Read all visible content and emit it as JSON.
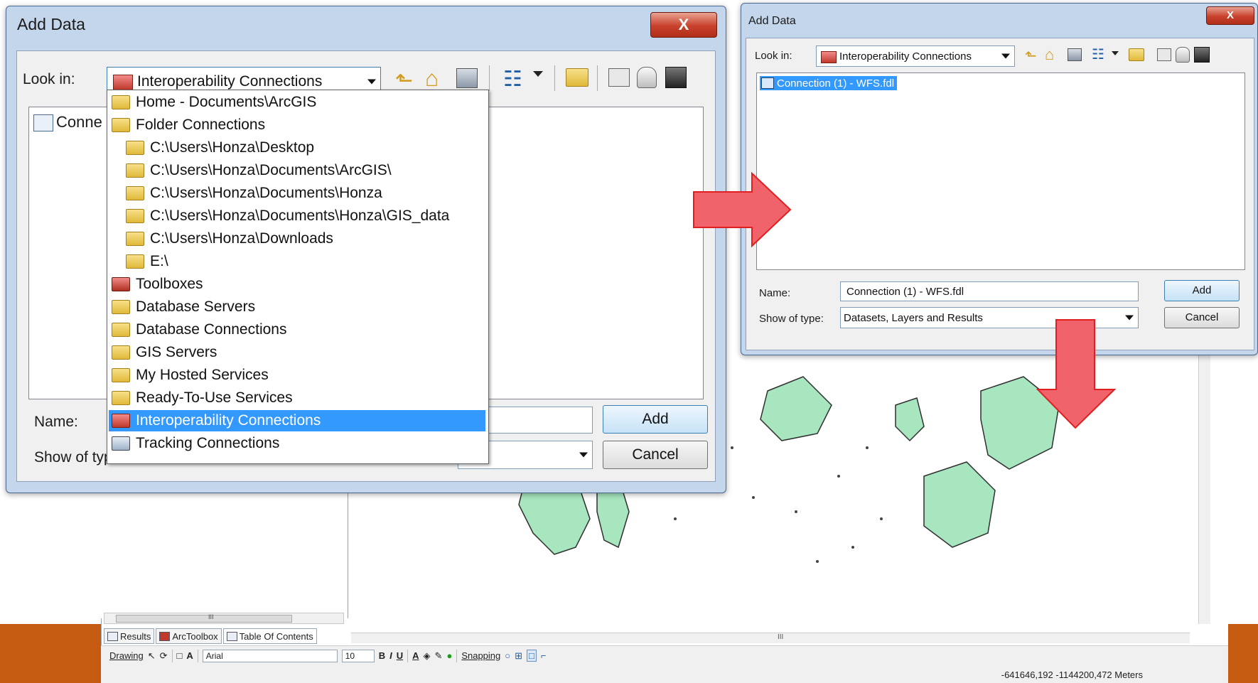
{
  "left_dialog": {
    "title": "Add Data",
    "look_in_label": "Look in:",
    "look_in_value": "Interoperability Connections",
    "list_item_partial": "Conne",
    "name_label": "Name:",
    "show_type_label": "Show of typ",
    "add_button": "Add",
    "cancel_button": "Cancel",
    "close_button": "X"
  },
  "dropdown": {
    "items": [
      {
        "label": "Home - Documents\\ArcGIS",
        "icon": "home-folder-icon"
      },
      {
        "label": "Folder Connections",
        "icon": "folder-connections-icon"
      },
      {
        "label": "C:\\Users\\Honza\\Desktop",
        "icon": "folder-icon"
      },
      {
        "label": "C:\\Users\\Honza\\Documents\\ArcGIS\\",
        "icon": "folder-icon"
      },
      {
        "label": "C:\\Users\\Honza\\Documents\\Honza",
        "icon": "folder-icon"
      },
      {
        "label": "C:\\Users\\Honza\\Documents\\Honza\\GIS_data",
        "icon": "folder-icon"
      },
      {
        "label": "C:\\Users\\Honza\\Downloads",
        "icon": "folder-icon"
      },
      {
        "label": "E:\\",
        "icon": "folder-icon"
      },
      {
        "label": "Toolboxes",
        "icon": "toolbox-icon"
      },
      {
        "label": "Database Servers",
        "icon": "database-servers-icon"
      },
      {
        "label": "Database Connections",
        "icon": "database-connections-icon"
      },
      {
        "label": "GIS Servers",
        "icon": "gis-servers-icon"
      },
      {
        "label": "My Hosted Services",
        "icon": "hosted-services-icon"
      },
      {
        "label": "Ready-To-Use Services",
        "icon": "ready-services-icon"
      },
      {
        "label": "Interoperability Connections",
        "icon": "interoperability-icon",
        "selected": true
      },
      {
        "label": "Tracking Connections",
        "icon": "tracking-icon"
      }
    ]
  },
  "right_dialog": {
    "title": "Add Data",
    "look_in_label": "Look in:",
    "look_in_value": "Interoperability Connections",
    "list_item": "Connection (1) -  WFS.fdl",
    "name_label": "Name:",
    "name_value": "Connection (1) -  WFS.fdl",
    "show_type_label": "Show of type:",
    "show_type_value": "Datasets, Layers and Results",
    "add_button": "Add",
    "cancel_button": "Cancel",
    "close_button": "X"
  },
  "arcmap": {
    "toc_tabs": [
      "Results",
      "ArcToolbox",
      "Table Of Contents"
    ],
    "drawing_label": "Drawing",
    "font_name": "Arial",
    "font_size": "10",
    "bold": "B",
    "italic": "I",
    "underline": "U",
    "snapping_label": "Snapping",
    "coordinates": "-641646,192  -1144200,472 Meters",
    "scroll_glyph": "III"
  },
  "colors": {
    "accent_band": "#c55a11",
    "arrow_fill": "#f0636b",
    "selection": "#3399ff",
    "map_polygon": "#a8e6c0"
  }
}
